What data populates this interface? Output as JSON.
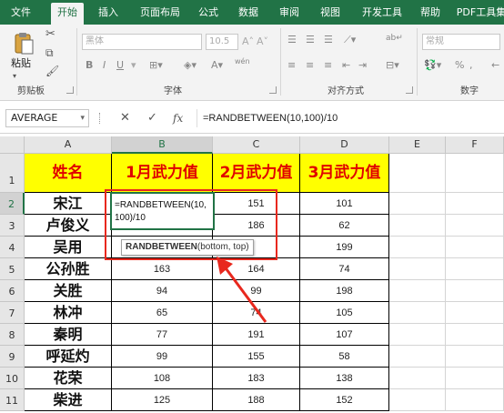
{
  "ribbon_tabs": [
    "文件",
    "开始",
    "插入",
    "页面布局",
    "公式",
    "数据",
    "审阅",
    "视图",
    "开发工具",
    "帮助",
    "PDF工具集"
  ],
  "active_tab": "开始",
  "clipboard": {
    "paste_label": "粘贴",
    "group_label": "剪贴板"
  },
  "font_group": {
    "font_name": "黑体",
    "font_size": "10.5",
    "group_label": "字体",
    "wen_label": "wén"
  },
  "align_group": {
    "group_label": "对齐方式"
  },
  "number_group": {
    "format": "常规",
    "group_label": "数字",
    "percent_label": "%"
  },
  "formula_bar": {
    "name_box": "AVERAGE",
    "fx": "fx",
    "formula": "=RANDBETWEEN(10,100)/10"
  },
  "columns": [
    "A",
    "B",
    "C",
    "D",
    "E",
    "F"
  ],
  "selected_column": "B",
  "rows": [
    "1",
    "2",
    "3",
    "4",
    "5",
    "6",
    "7",
    "8",
    "9",
    "10",
    "11"
  ],
  "selected_row": "2",
  "table": {
    "headers": [
      "姓名",
      "1月武力值",
      "2月武力值",
      "3月武力值"
    ],
    "data": [
      [
        "宋江",
        "",
        "151",
        "101"
      ],
      [
        "卢俊义",
        "",
        "186",
        "62"
      ],
      [
        "吴用",
        "",
        "",
        "199"
      ],
      [
        "公孙胜",
        "163",
        "164",
        "74"
      ],
      [
        "关胜",
        "94",
        "99",
        "198"
      ],
      [
        "林冲",
        "65",
        "74",
        "105"
      ],
      [
        "秦明",
        "77",
        "191",
        "107"
      ],
      [
        "呼延灼",
        "99",
        "155",
        "58"
      ],
      [
        "花荣",
        "108",
        "183",
        "138"
      ],
      [
        "柴进",
        "125",
        "188",
        "152"
      ]
    ]
  },
  "edit_cell": {
    "line1": "=RANDBETWEEN(10,",
    "line2": "100)/10"
  },
  "tooltip": {
    "func": "RANDBETWEEN",
    "args": "(bottom, top)"
  },
  "colors": {
    "excel_green": "#217346",
    "header_fill": "#ffff00",
    "header_text": "#e00000",
    "annotation_red": "#e8281e"
  }
}
